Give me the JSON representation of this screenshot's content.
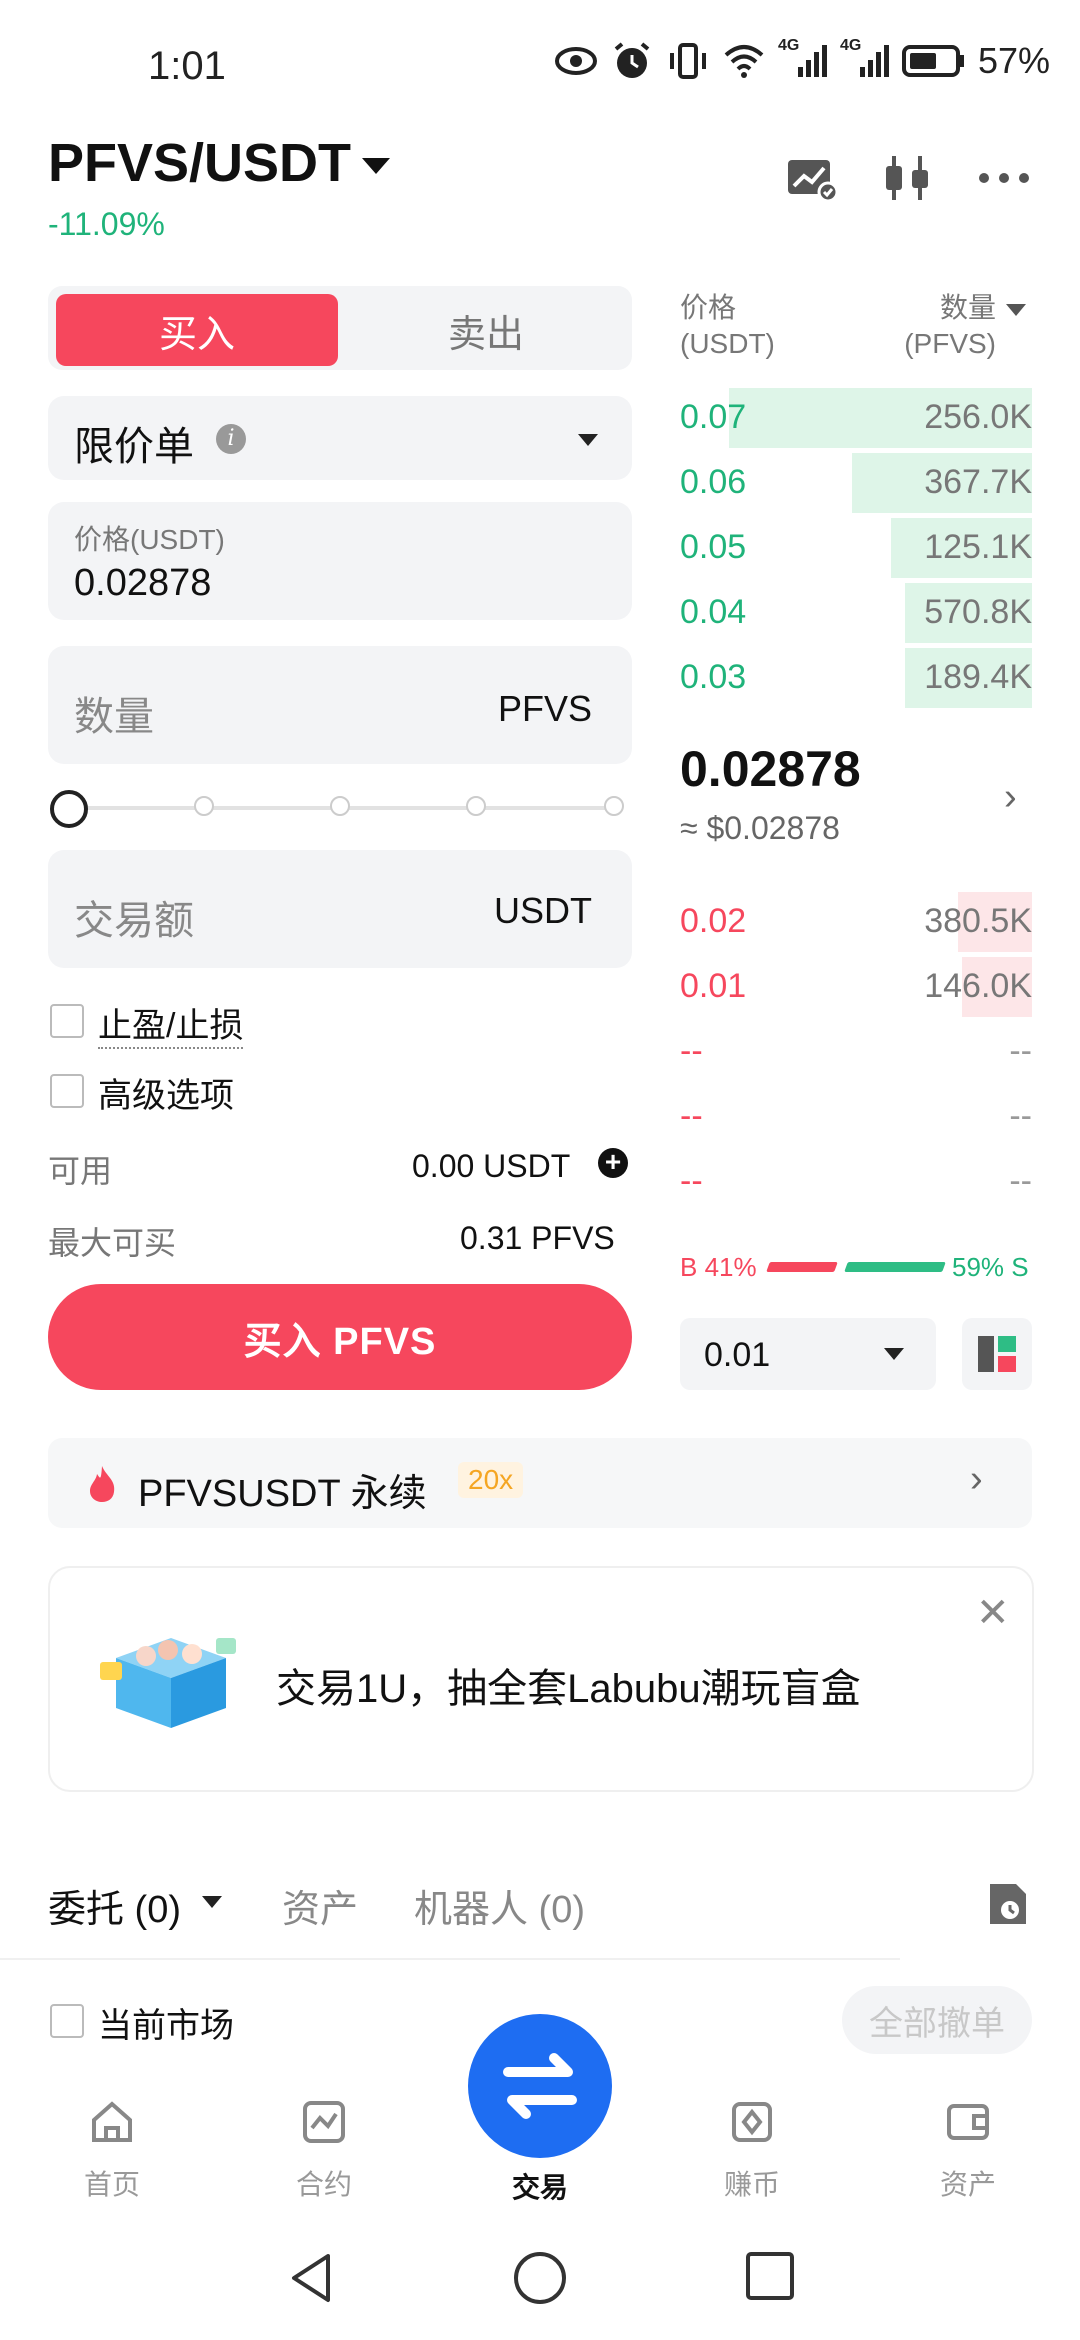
{
  "status_bar": {
    "time": "1:01",
    "network_a": "4G",
    "network_b": "4G",
    "battery": "57%"
  },
  "header": {
    "pair": "PFVS/USDT",
    "change": "-11.09%"
  },
  "order_side": {
    "buy_label": "买入",
    "sell_label": "卖出",
    "active": "buy"
  },
  "order_form": {
    "order_type": "限价单",
    "price_label": "价格(USDT)",
    "price_value": "0.02878",
    "qty_placeholder": "数量",
    "qty_unit": "PFVS",
    "slider_percent": 0,
    "amount_placeholder": "交易额",
    "amount_unit": "USDT",
    "tp_sl_label": "止盈/止损",
    "advanced_label": "高级选项",
    "available_label": "可用",
    "available_value": "0.00 USDT",
    "max_buy_label": "最大可买",
    "max_buy_value": "0.31 PFVS",
    "submit_label": "买入 PFVS"
  },
  "orderbook": {
    "price_header_l1": "价格",
    "price_header_l2": "(USDT)",
    "qty_header_l1": "数量",
    "qty_header_l2": "(PFVS)",
    "asks": [
      {
        "price": "0.07",
        "qty": "256.0K",
        "depth": 0.86
      },
      {
        "price": "0.06",
        "qty": "367.7K",
        "depth": 0.51
      },
      {
        "price": "0.05",
        "qty": "125.1K",
        "depth": 0.4
      },
      {
        "price": "0.04",
        "qty": "570.8K",
        "depth": 0.36
      },
      {
        "price": "0.03",
        "qty": "189.4K",
        "depth": 0.36
      }
    ],
    "last_price": "0.02878",
    "last_price_usd": "≈ $0.02878",
    "bids": [
      {
        "price": "0.02",
        "qty": "380.5K",
        "depth": 0.21
      },
      {
        "price": "0.01",
        "qty": "146.0K",
        "depth": 0.2
      },
      {
        "price": "--",
        "qty": "--",
        "depth": 0
      },
      {
        "price": "--",
        "qty": "--",
        "depth": 0
      },
      {
        "price": "--",
        "qty": "--",
        "depth": 0
      }
    ],
    "buy_ratio": "B 41%",
    "sell_ratio": "59% S",
    "depth_step": "0.01"
  },
  "perpetual": {
    "label": "PFVSUSDT 永续",
    "leverage": "20x"
  },
  "banner": {
    "text": "交易1U，抽全套Labubu潮玩盲盒"
  },
  "bottom_tabs": {
    "orders": "委托 (0)",
    "assets": "资产",
    "bots": "机器人 (0)"
  },
  "filter": {
    "current_market": "当前市场",
    "cancel_all": "全部撤单"
  },
  "nav": {
    "home": "首页",
    "futures": "合约",
    "trade": "交易",
    "earn": "赚币",
    "assets": "资产"
  },
  "colors": {
    "buy": "#f6475d",
    "sell_green": "#1fb37a",
    "accent_blue": "#1e6df2"
  }
}
